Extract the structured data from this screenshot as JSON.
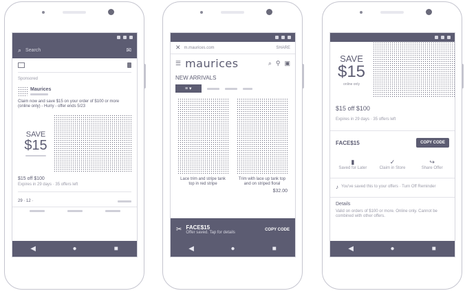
{
  "phone1": {
    "search_placeholder": "Search",
    "sponsored": "Sponsored",
    "brand": "Maurices",
    "post_text": "Claim now and save $15 on your order of $100 or more (online only) - Hurry - offer ends 5/23",
    "ad_save": "SAVE",
    "ad_amount": "$15",
    "offer_title": "$15 off $100",
    "offer_sub": "Expires in 29 days · 35 offers left",
    "reactions": "29 · 12 ·"
  },
  "phone2": {
    "url": "m.maurices.com",
    "share": "SHARE",
    "brand": "maurices",
    "section": "NEW ARRIVALS",
    "filter_label": "≡ ▾",
    "product1_name": "Lace trim and stripe tank top in red stripe",
    "product2_name": "Trim with lace up tank top and on striped floral",
    "product2_price": "$32.00",
    "coupon_code": "FACE$15",
    "coupon_sub": "Offer saved. Tap for details",
    "copy_label": "COPY CODE"
  },
  "phone3": {
    "ad_save": "SAVE",
    "ad_amount": "$15",
    "ad_note": "online only",
    "offer_title": "$15 off $100",
    "offer_expiry": "Expires in 29 days · 35 offers left",
    "code": "FACE$15",
    "copy_label": "COPY CODE",
    "actions": [
      "Saved for Later",
      "Claim in Store",
      "Share Offer"
    ],
    "remind_text": "You've saved this to your offers · Turn Off Reminder",
    "details_label": "Details",
    "details_text": "Valid on orders of $100 or more. Online only. Cannot be combined with other offers."
  }
}
